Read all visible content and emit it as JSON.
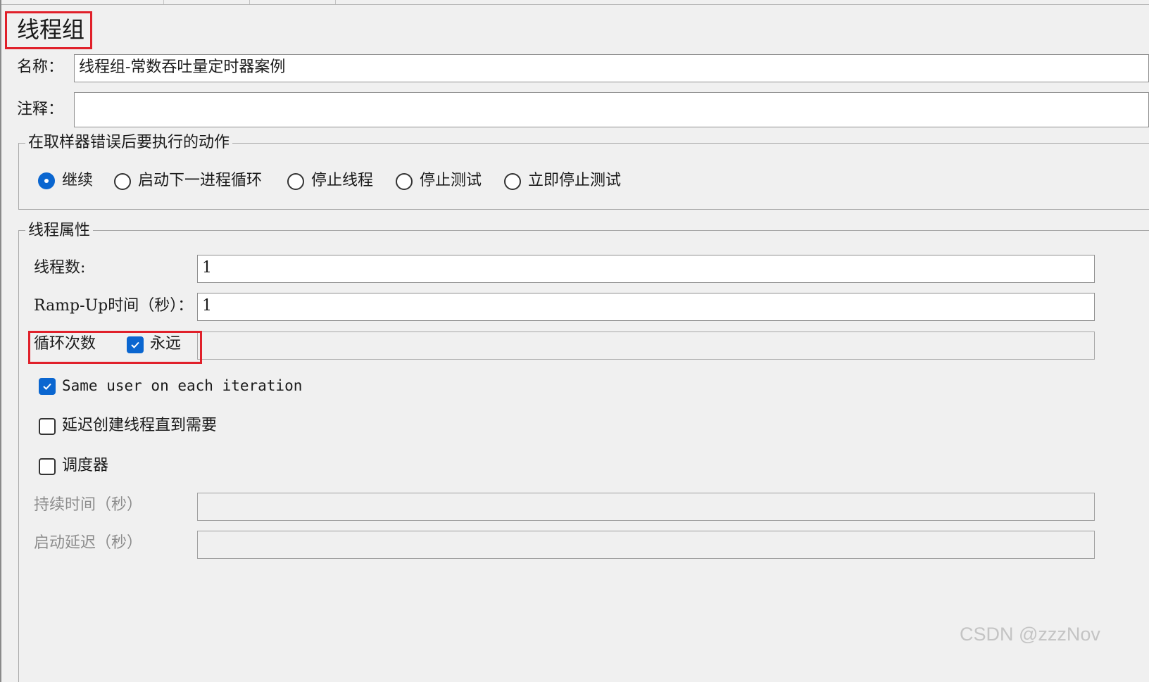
{
  "panel": {
    "title": "线程组"
  },
  "name_field": {
    "label": "名称：",
    "value": "线程组-常数吞吐量定时器案例"
  },
  "comment_field": {
    "label": "注释：",
    "value": ""
  },
  "sampler_error": {
    "legend": "在取样器错误后要执行的动作",
    "options": [
      {
        "label": "继续",
        "selected": true
      },
      {
        "label": "启动下一进程循环",
        "selected": false
      },
      {
        "label": "停止线程",
        "selected": false
      },
      {
        "label": "停止测试",
        "selected": false
      },
      {
        "label": "立即停止测试",
        "selected": false
      }
    ]
  },
  "thread_props": {
    "legend": "线程属性",
    "threads": {
      "label": "线程数:",
      "value": "1"
    },
    "rampup": {
      "label": "Ramp-Up时间（秒）：",
      "value": "1"
    },
    "loop": {
      "label": "循环次数",
      "forever_label": "永远",
      "forever_checked": true,
      "value": ""
    },
    "same_user": {
      "label": "Same user on each iteration",
      "checked": true
    },
    "delay_create": {
      "label": "延迟创建线程直到需要",
      "checked": false
    },
    "scheduler": {
      "label": "调度器",
      "checked": false
    },
    "duration": {
      "label": "持续时间（秒）",
      "value": ""
    },
    "startup_delay": {
      "label": "启动延迟（秒）",
      "value": ""
    }
  },
  "watermark": "CSDN @zzzNov",
  "colors": {
    "accent": "#0a66d0",
    "highlight": "#e0202a",
    "background": "#f0f0f0"
  }
}
